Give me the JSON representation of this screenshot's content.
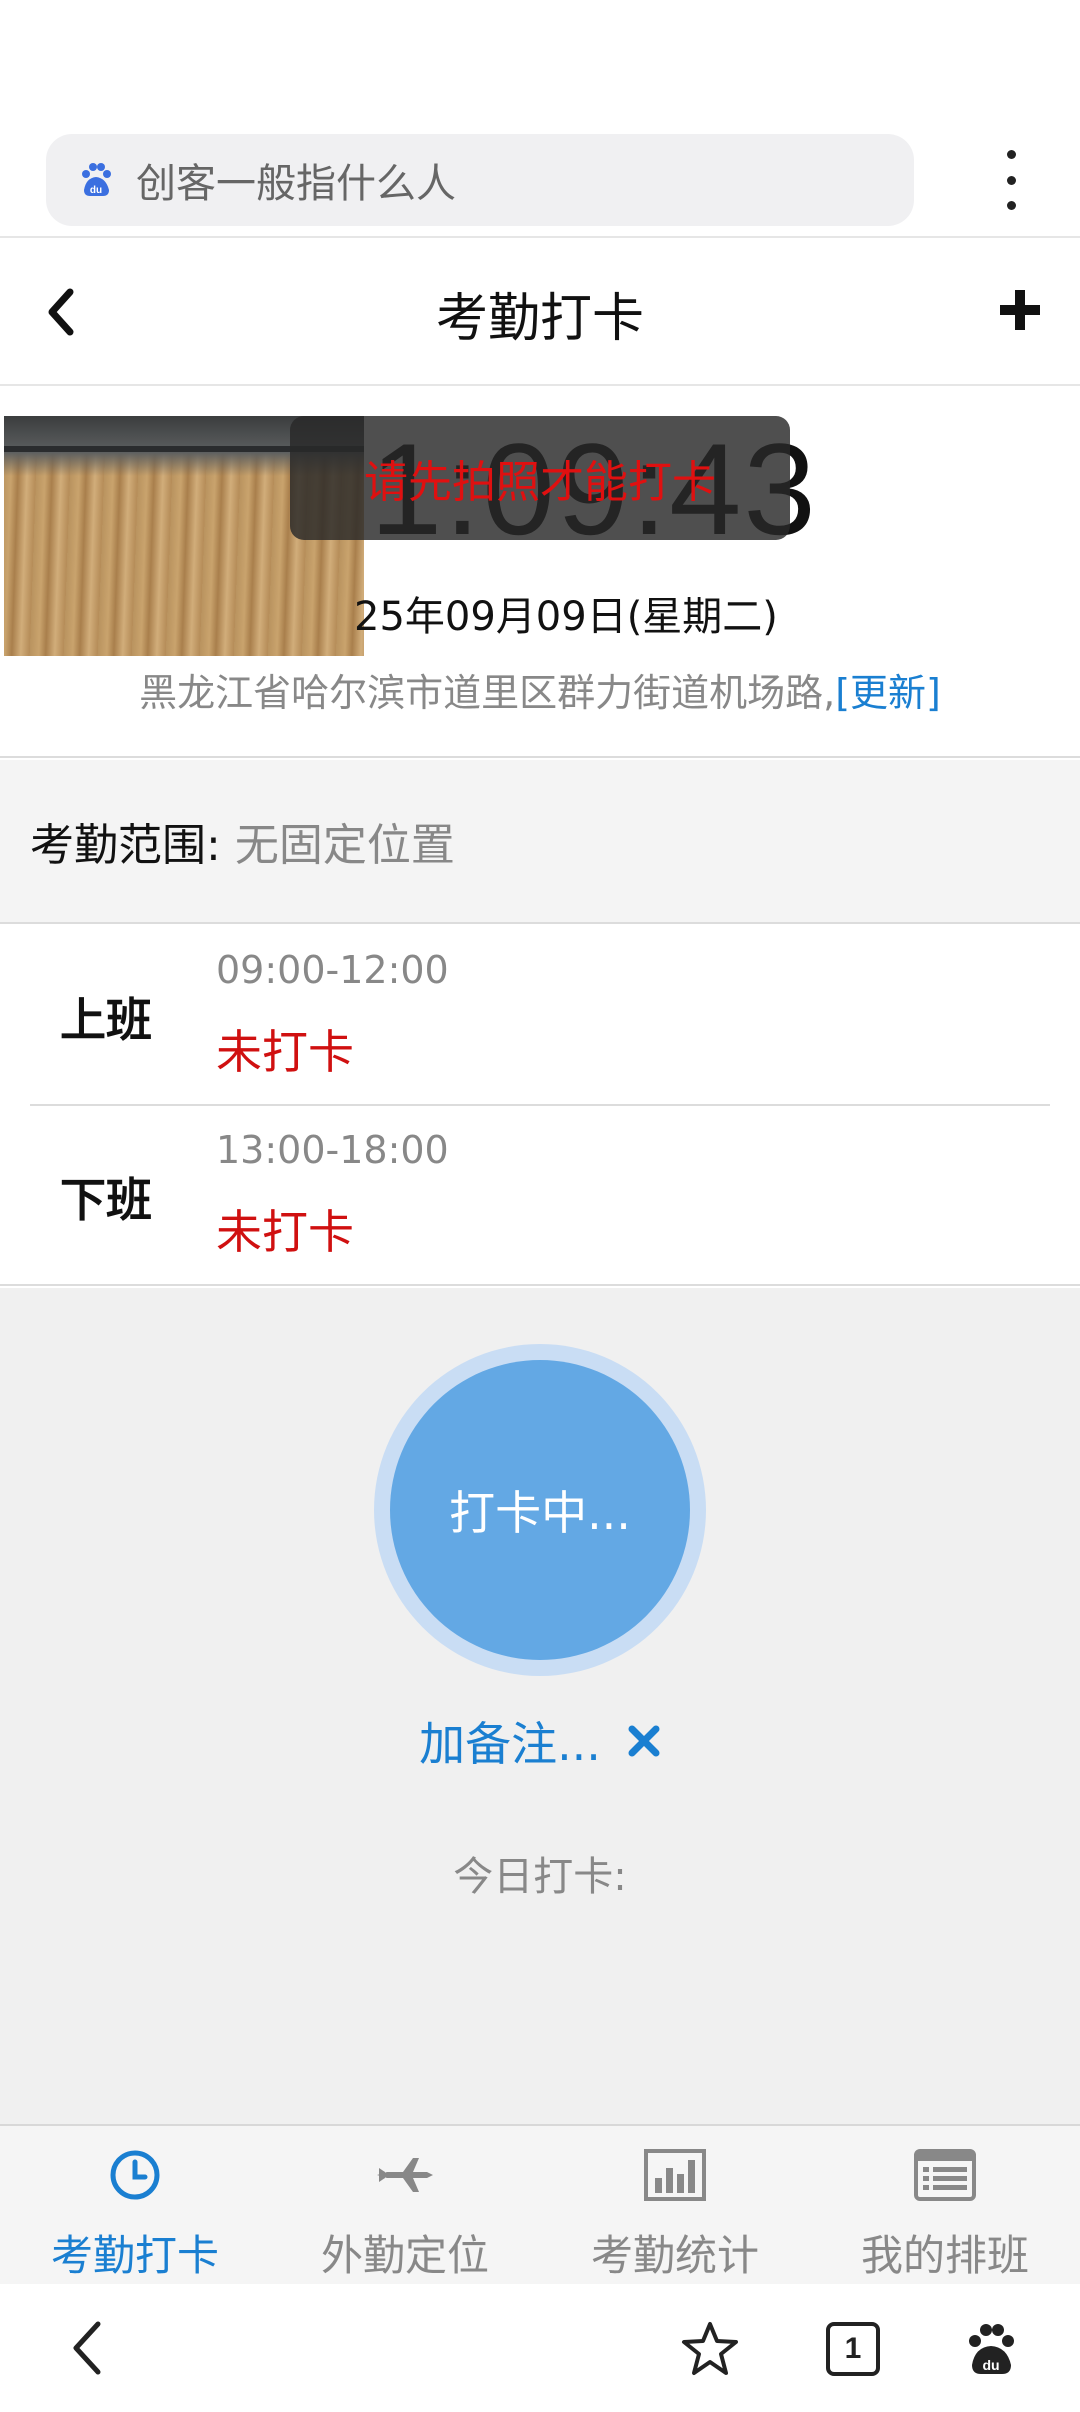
{
  "browser": {
    "search_text": "创客一般指什么人",
    "tab_count": "1"
  },
  "header": {
    "title": "考勤打卡"
  },
  "clock": {
    "time": "1:09:43",
    "date": "25年09月09日(星期二)",
    "toast": "请先拍照才能打卡",
    "address": "黑龙江省哈尔滨市道里区群力街道机场路,",
    "refresh_label": "[更新]"
  },
  "range": {
    "label": "考勤范围:",
    "value": "无固定位置"
  },
  "shifts": [
    {
      "name": "上班",
      "time": "09:00-12:00",
      "status": "未打卡"
    },
    {
      "name": "下班",
      "time": "13:00-18:00",
      "status": "未打卡"
    }
  ],
  "punch": {
    "button_label": "打卡中...",
    "note_label": "加备注...",
    "today_label": "今日打卡:"
  },
  "tabs": [
    {
      "label": "考勤打卡",
      "icon": "clock-icon",
      "active": true
    },
    {
      "label": "外勤定位",
      "icon": "airplane-icon",
      "active": false
    },
    {
      "label": "考勤统计",
      "icon": "bar-chart-icon",
      "active": false
    },
    {
      "label": "我的排班",
      "icon": "list-icon",
      "active": false
    }
  ],
  "colors": {
    "accent": "#1a7fd1",
    "punch_button": "#63a8e4",
    "alert_red": "#d01010"
  }
}
